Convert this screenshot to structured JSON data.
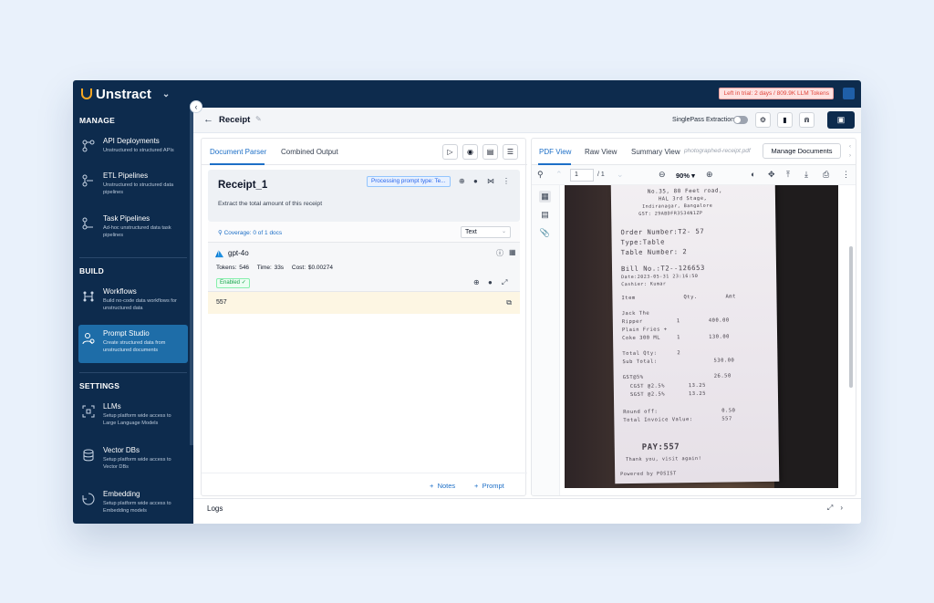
{
  "app": {
    "name": "Unstract",
    "trial_text": "Left in trial: 2 days / 809.9K LLM Tokens"
  },
  "sidebar": {
    "sections": {
      "manage": "MANAGE",
      "build": "BUILD",
      "settings": "SETTINGS"
    },
    "items": [
      {
        "title": "API Deployments",
        "desc": "Unstructured to structured APIs"
      },
      {
        "title": "ETL Pipelines",
        "desc": "Unstructured to structured data pipelines"
      },
      {
        "title": "Task Pipelines",
        "desc": "Ad-hoc unstructured data task pipelines"
      },
      {
        "title": "Workflows",
        "desc": "Build no-code data workflows for unstructured data"
      },
      {
        "title": "Prompt Studio",
        "desc": "Create structured data from unstructured documents"
      },
      {
        "title": "LLMs",
        "desc": "Setup platform wide access to Large Language Models"
      },
      {
        "title": "Vector DBs",
        "desc": "Setup platform wide access to Vector DBs"
      },
      {
        "title": "Embedding",
        "desc": "Setup platform wide access to Embedding models"
      }
    ]
  },
  "header": {
    "title": "Receipt",
    "singlepass_label": "SinglePass Extraction"
  },
  "left_panel": {
    "tabs": [
      "Document Parser",
      "Combined Output"
    ],
    "prompt": {
      "name": "Receipt_1",
      "text": "Extract the total amount of this receipt",
      "status": "Processing prompt type: Te..."
    },
    "coverage": "Coverage: 0 of 1 docs",
    "output_type": "Text",
    "llm": {
      "name": "gpt-4o",
      "tokens": "Tokens: 546",
      "time": "Time: 33s",
      "cost": "Cost: $0.00274",
      "enabled_label": "Enabled"
    },
    "result": "557",
    "footer": {
      "notes": "Notes",
      "prompt": "Prompt"
    }
  },
  "right_panel": {
    "tabs": [
      "PDF View",
      "Raw View",
      "Summary View"
    ],
    "file_name": "photographed-receipt.pdf",
    "manage_button": "Manage Documents",
    "page_current": "1",
    "page_total": "/ 1",
    "zoom": "90%"
  },
  "receipt": {
    "lines": [
      "No.35, 80 Feet road,",
      "HAL 3rd Stage,",
      "Indiranagar, Bangalore",
      "GST: 29ABDFR3534N1ZP",
      "Order Number:T2- 57",
      "Type:Table",
      "Table Number: 2",
      "Bill No.:T2--126653",
      "Date:2023-05-31 23:16:50",
      "Cashier: Kumar",
      "Item",
      "Qty.",
      "Amt",
      "Jack The",
      "Ripper",
      "1",
      "400.00",
      "Plain Fries +",
      "Coke 300 ML",
      "1",
      "130.00",
      "Total Qty:",
      "2",
      "Sub Total:",
      "530.00",
      "GST@5%",
      "26.50",
      "CGST @2.5%",
      "13.25",
      "SGST @2.5%",
      "13.25",
      "Round off:",
      "0.50",
      "Total Invoice Value:",
      "557",
      "PAY:557",
      "Thank you, visit again!",
      "Powered by   POSIST"
    ]
  },
  "logs": {
    "label": "Logs"
  },
  "colors": {
    "navy": "#0d2b4d",
    "accent_blue": "#1d6fc7",
    "active_item": "#1e6da8",
    "brand_orange": "#f5a623"
  }
}
